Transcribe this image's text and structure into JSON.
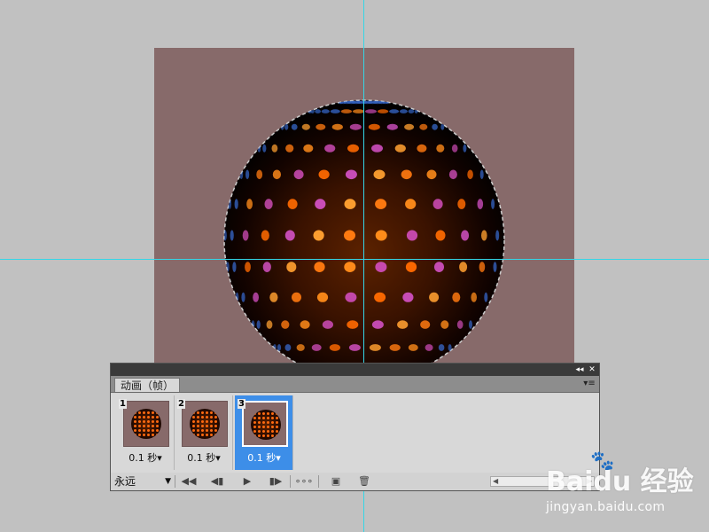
{
  "panel": {
    "tab_label": "动画（帧）",
    "collapse_icon": "◂◂",
    "close_icon": "✕",
    "menu_icon": "▾≡"
  },
  "frames": [
    {
      "number": "1",
      "delay": "0.1 秒▾",
      "selected": false
    },
    {
      "number": "2",
      "delay": "0.1 秒▾",
      "selected": false
    },
    {
      "number": "3",
      "delay": "0.1 秒▾",
      "selected": true
    }
  ],
  "controls": {
    "loop_value": "永远",
    "loop_caret": "▼",
    "first_frame": "◀◀",
    "prev_frame": "◀▮",
    "play": "▶",
    "next_frame": "▮▶",
    "tween": "∘∘∘",
    "new_frame": "▣",
    "delete_frame": "🗑",
    "scroll_left": "◀",
    "scroll_right": "▶"
  },
  "watermark": {
    "brand": "Baidu 经验",
    "paw": "🐾",
    "url": "jingyan.baidu.com"
  },
  "colors": {
    "canvas_bg": "#876a6a",
    "workspace": "#c1c1c1",
    "guide": "#34d6e6",
    "selection": "#3d8ee8"
  }
}
